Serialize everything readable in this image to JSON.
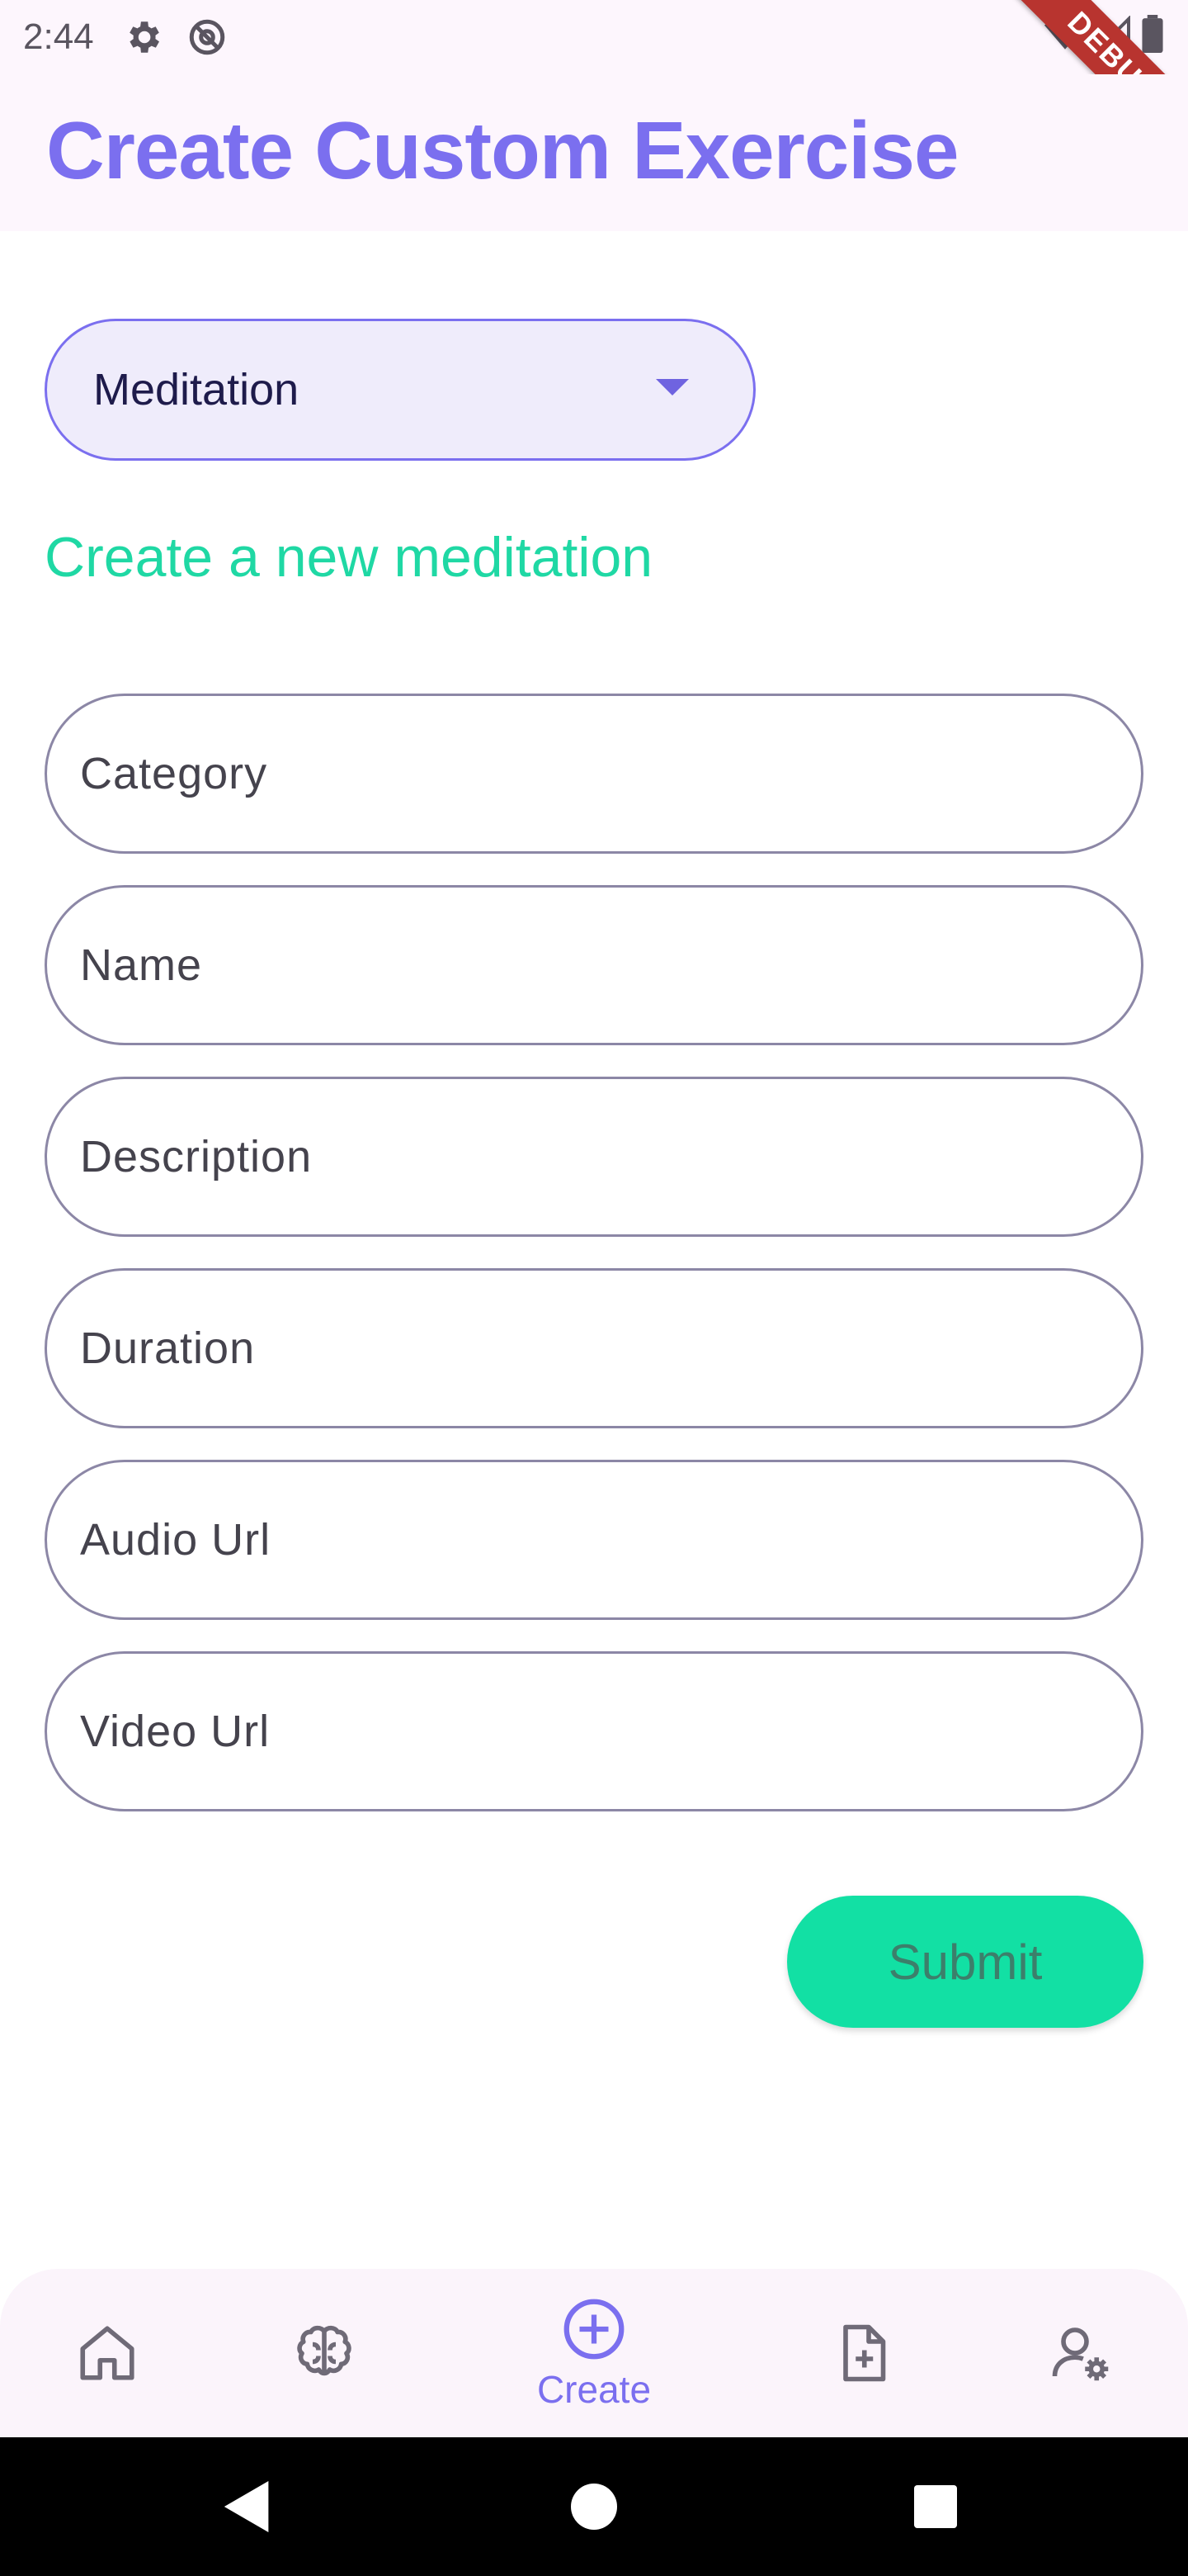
{
  "status_bar": {
    "time": "2:44",
    "icons": [
      "gear-icon",
      "at-sign-icon",
      "wifi-icon",
      "signal-icon",
      "battery-icon"
    ],
    "debug_banner": "DEBUG"
  },
  "app_bar": {
    "title": "Create Custom Exercise",
    "title_color": "#7b6fef"
  },
  "exercise_type": {
    "selected": "Meditation",
    "icon": "dropdown-arrow-icon"
  },
  "form": {
    "section_title": "Create a new meditation",
    "section_title_color": "#1fd8a4",
    "fields": [
      {
        "label": "Category",
        "value": ""
      },
      {
        "label": "Name",
        "value": ""
      },
      {
        "label": "Description",
        "value": ""
      },
      {
        "label": "Duration",
        "value": ""
      },
      {
        "label": "Audio Url",
        "value": ""
      },
      {
        "label": "Video Url",
        "value": ""
      }
    ],
    "submit_label": "Submit",
    "submit_color": "#12e0a4"
  },
  "bottom_nav": {
    "items": [
      {
        "icon": "home-icon",
        "label": "",
        "active": false
      },
      {
        "icon": "brain-icon",
        "label": "",
        "active": false
      },
      {
        "icon": "add-circle-icon",
        "label": "Create",
        "active": true
      },
      {
        "icon": "add-file-icon",
        "label": "",
        "active": false
      },
      {
        "icon": "user-settings-icon",
        "label": "",
        "active": false
      }
    ]
  },
  "system_nav": {
    "icons": [
      "back-icon",
      "home-circle-icon",
      "recents-icon"
    ]
  }
}
